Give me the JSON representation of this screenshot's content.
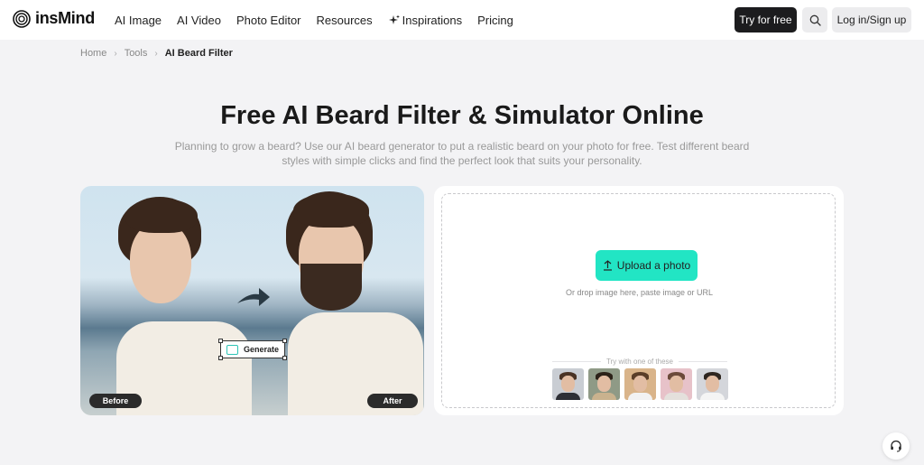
{
  "brand": {
    "name": "insMind"
  },
  "nav": {
    "items": [
      {
        "label": "AI Image"
      },
      {
        "label": "AI Video"
      },
      {
        "label": "Photo Editor"
      },
      {
        "label": "Resources"
      },
      {
        "label": "Inspirations",
        "icon": "sparkle-icon"
      },
      {
        "label": "Pricing"
      }
    ],
    "try_label": "Try for free",
    "login_label": "Log in/Sign up"
  },
  "breadcrumb": {
    "home": "Home",
    "tools": "Tools",
    "current": "AI Beard Filter"
  },
  "hero": {
    "title": "Free AI Beard Filter & Simulator Online",
    "subtitle": "Planning to grow a beard? Use our AI beard generator to put a realistic beard on your photo for free. Test different beard styles with simple clicks and find the perfect look that suits your personality."
  },
  "preview": {
    "before_label": "Before",
    "after_label": "After",
    "generate_label": "Generate"
  },
  "upload": {
    "button_label": "Upload a photo",
    "hint": "Or drop image here, paste image or URL",
    "try_label": "Try with one of these"
  },
  "colors": {
    "accent": "#22e5c4",
    "dark_button": "#1c1c1e"
  }
}
